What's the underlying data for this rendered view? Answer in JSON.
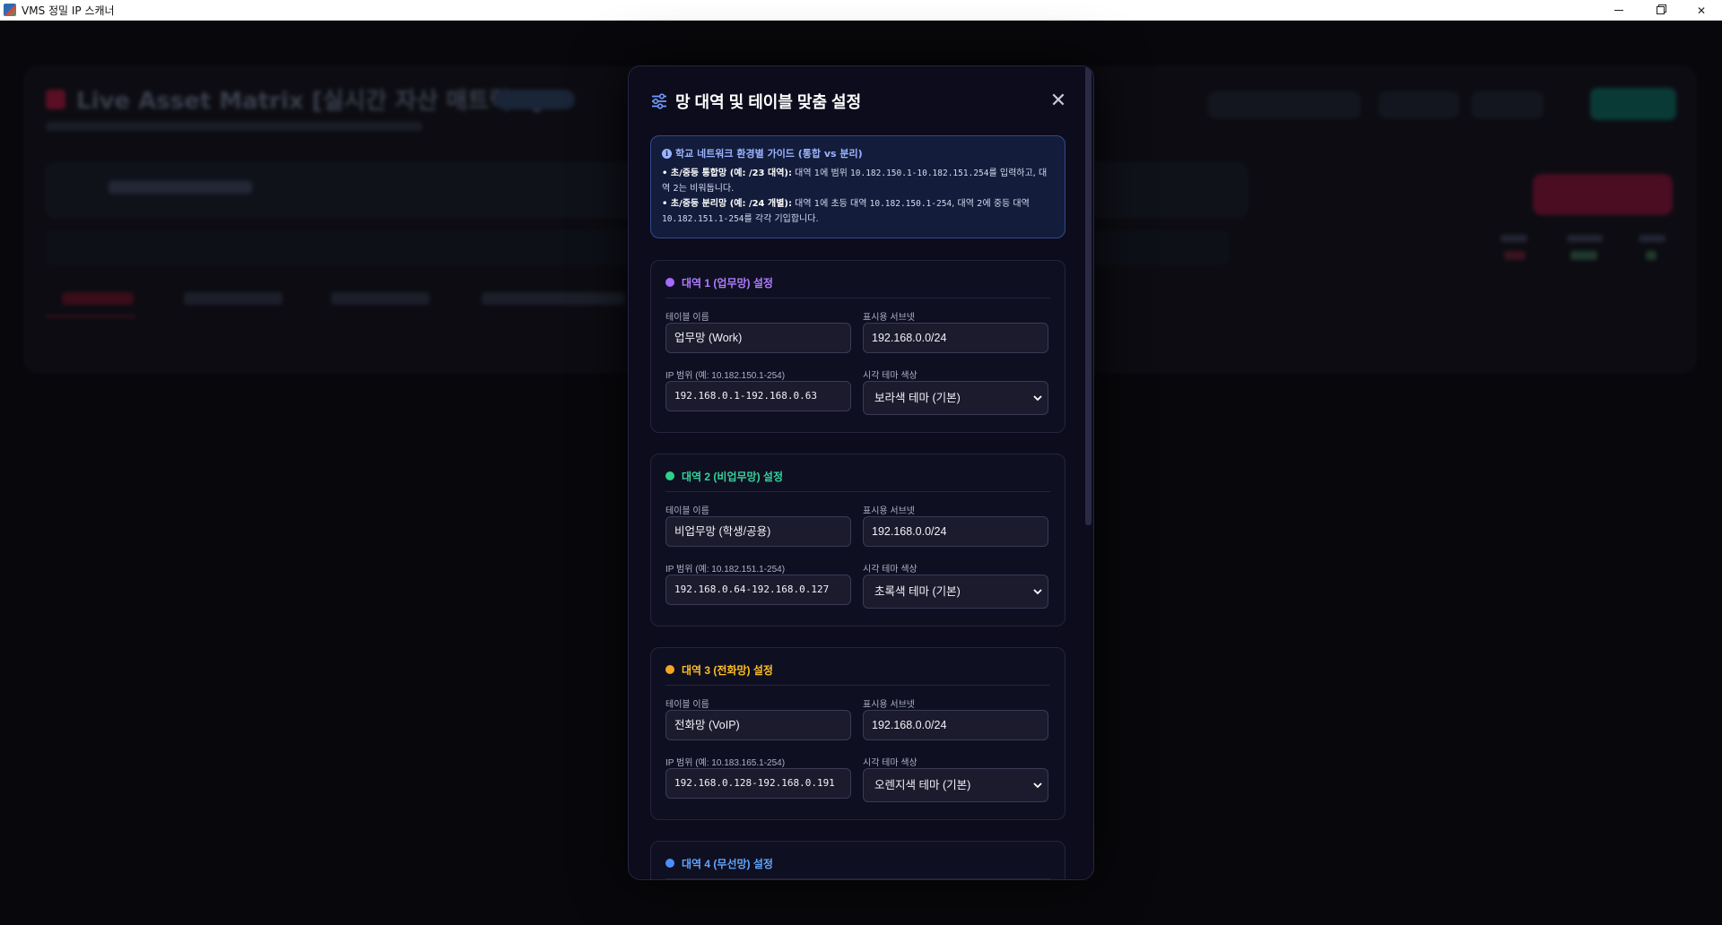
{
  "window": {
    "title": "VMS 정밀 IP 스캐너"
  },
  "background": {
    "app_title": "Live Asset Matrix [실시간 자산 매트릭스]"
  },
  "modal": {
    "title": "망 대역 및 테이블 맞춤 설정",
    "guide": {
      "title": "학교 네트워크 환경별 가이드 (통합 vs 분리)",
      "line1_bold": "• 초/중등 통합망 (예: /23 대역):",
      "line1_pre": " 대역 1에 범위 ",
      "line1_mono": "10.182.150.1-10.182.151.254",
      "line1_post": "를 입력하고, 대역 2는 비워둡니다.",
      "line2_bold": "• 초/중등 분리망 (예: /24 개별):",
      "line2_pre": " 대역 1에 초등 대역 ",
      "line2_mono1": "10.182.150.1-254",
      "line2_mid": ", 대역 2에 중등 대역 ",
      "line2_mono2": "10.182.151.1-254",
      "line2_post": "를 각각 기입합니다."
    },
    "labels": {
      "table_name": "테이블 이름",
      "display_subnet": "표시용 서브넷",
      "theme_color": "시각 테마 색상"
    },
    "bands": [
      {
        "title": "대역 1 (업무망) 설정",
        "color": "#a66bff",
        "table_name": "업무망 (Work)",
        "subnet": "192.168.0.0/24",
        "ip_label": "IP 범위 (예: 10.182.150.1-254)",
        "ip_range": "192.168.0.1-192.168.0.63",
        "theme": "보라색 테마 (기본)"
      },
      {
        "title": "대역 2 (비업무망) 설정",
        "color": "#2fd08a",
        "table_name": "비업무망 (학생/공용)",
        "subnet": "192.168.0.0/24",
        "ip_label": "IP 범위 (예: 10.182.151.1-254)",
        "ip_range": "192.168.0.64-192.168.0.127",
        "theme": "초록색 테마 (기본)"
      },
      {
        "title": "대역 3 (전화망) 설정",
        "color": "#f5a623",
        "table_name": "전화망 (VoIP)",
        "subnet": "192.168.0.0/24",
        "ip_label": "IP 범위 (예: 10.183.165.1-254)",
        "ip_range": "192.168.0.128-192.168.0.191",
        "theme": "오렌지색 테마 (기본)"
      },
      {
        "title": "대역 4 (무선망) 설정",
        "color": "#4d8dff"
      }
    ]
  }
}
